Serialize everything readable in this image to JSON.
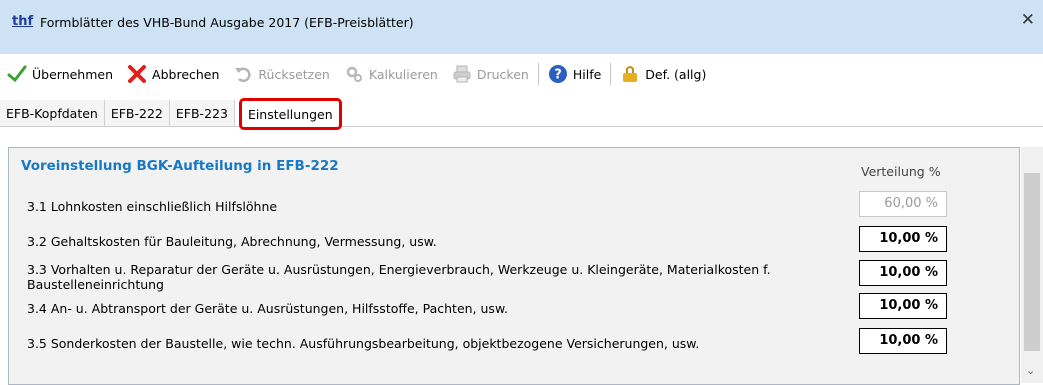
{
  "window": {
    "app_icon_text": "thf",
    "title": "Formblätter des VHB-Bund Ausgabe 2017 (EFB-Preisblätter)",
    "close_glyph": "✕"
  },
  "toolbar": {
    "accept_label": "Übernehmen",
    "cancel_label": "Abbrechen",
    "reset_label": "Rücksetzen",
    "calculate_label": "Kalkulieren",
    "print_label": "Drucken",
    "help_label": "Hilfe",
    "defaults_label": "Def. (allg)",
    "icons": [
      "checkmark-icon",
      "cross-icon",
      "undo-icon",
      "gears-icon",
      "printer-icon",
      "help-icon",
      "defaults-icon"
    ]
  },
  "tabs": [
    {
      "label": "EFB-Kopfdaten"
    },
    {
      "label": "EFB-222"
    },
    {
      "label": "EFB-223"
    },
    {
      "label": "Einstellungen",
      "active": true
    }
  ],
  "panel": {
    "title": "Voreinstellung BGK-Aufteilung in EFB-222",
    "column_header": "Verteilung %",
    "rows": [
      {
        "label": "3.1 Lohnkosten einschließlich Hilfslöhne",
        "value": "60,00 %"
      },
      {
        "label": "3.2 Gehaltskosten für Bauleitung, Abrechnung, Vermessung, usw.",
        "value": "10,00 %"
      },
      {
        "label": "3.3 Vorhalten u. Reparatur der Geräte u. Ausrüstungen, Energieverbrauch, Werkzeuge u. Kleingeräte, Materialkosten f.",
        "label_line2": "Baustelleneinrichtung",
        "value": "10,00 %"
      },
      {
        "label": "3.4 An- u. Abtransport der Geräte u. Ausrüstungen, Hilfsstoffe, Pachten, usw.",
        "value": "10,00 %"
      },
      {
        "label": "3.5 Sonderkosten der Baustelle, wie techn. Ausführungsbearbeitung, objektbezogene Versicherungen, usw.",
        "value": "10,00 %"
      }
    ]
  },
  "colors": {
    "title_bar": "#cde3f5",
    "section_title": "#1a78c2",
    "active_tab_highlight": "#e00000"
  }
}
